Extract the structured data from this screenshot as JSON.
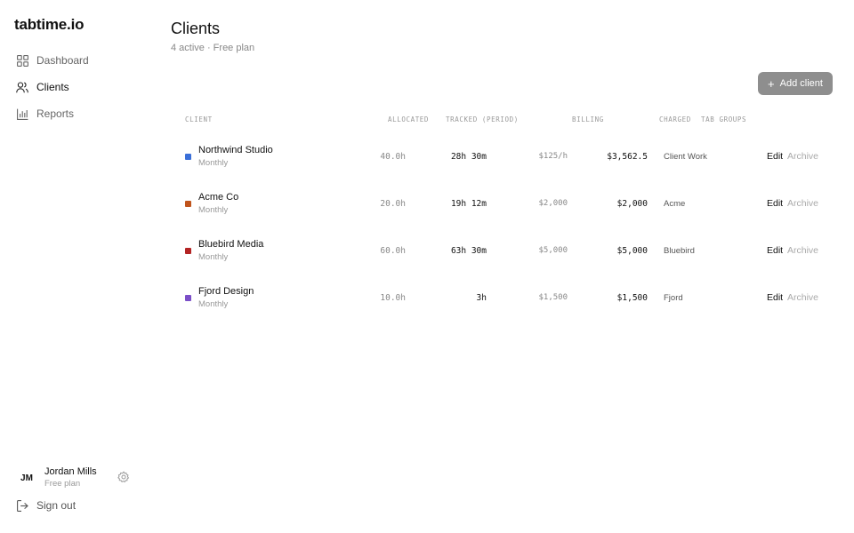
{
  "app": {
    "logo": "tabtime.io"
  },
  "sidebar": {
    "items": [
      {
        "label": "Dashboard",
        "icon": "grid-icon",
        "active": false
      },
      {
        "label": "Clients",
        "icon": "users-icon",
        "active": true
      },
      {
        "label": "Reports",
        "icon": "bar-chart-icon",
        "active": false
      }
    ],
    "user": {
      "initials": "JM",
      "name": "Jordan Mills",
      "plan": "Free plan",
      "settings_icon": "gear-icon"
    },
    "signout_label": "Sign out",
    "signout_icon": "sign-out-icon"
  },
  "page": {
    "title": "Clients",
    "subtitle": "4 active · Free plan"
  },
  "toolbar": {
    "add_label": "Add client",
    "add_icon": "plus-icon"
  },
  "table": {
    "headers": {
      "client": "CLIENT",
      "allocated": "ALLOCATED",
      "tracked": "TRACKED (PERIOD)",
      "billing": "BILLING",
      "charged": "CHARGED",
      "tab_groups": "TAB GROUPS"
    },
    "rows": [
      {
        "name": "Northwind Studio",
        "frequency": "Monthly",
        "color": "#3a6fd8",
        "allocated": "40.0h",
        "tracked": "28h 30m",
        "billing": "$125/h",
        "charged": "$3,562.5",
        "tab_group": "Client Work",
        "edit": "Edit",
        "archive": "Archive"
      },
      {
        "name": "Acme Co",
        "frequency": "Monthly",
        "color": "#c0541c",
        "allocated": "20.0h",
        "tracked": "19h 12m",
        "billing": "$2,000",
        "charged": "$2,000",
        "tab_group": "Acme",
        "edit": "Edit",
        "archive": "Archive"
      },
      {
        "name": "Bluebird Media",
        "frequency": "Monthly",
        "color": "#b32424",
        "allocated": "60.0h",
        "tracked": "63h 30m",
        "billing": "$5,000",
        "charged": "$5,000",
        "tab_group": "Bluebird",
        "edit": "Edit",
        "archive": "Archive"
      },
      {
        "name": "Fjord Design",
        "frequency": "Monthly",
        "color": "#7b4fc8",
        "allocated": "10.0h",
        "tracked": "3h",
        "billing": "$1,500",
        "charged": "$1,500",
        "tab_group": "Fjord",
        "edit": "Edit",
        "archive": "Archive"
      }
    ]
  }
}
